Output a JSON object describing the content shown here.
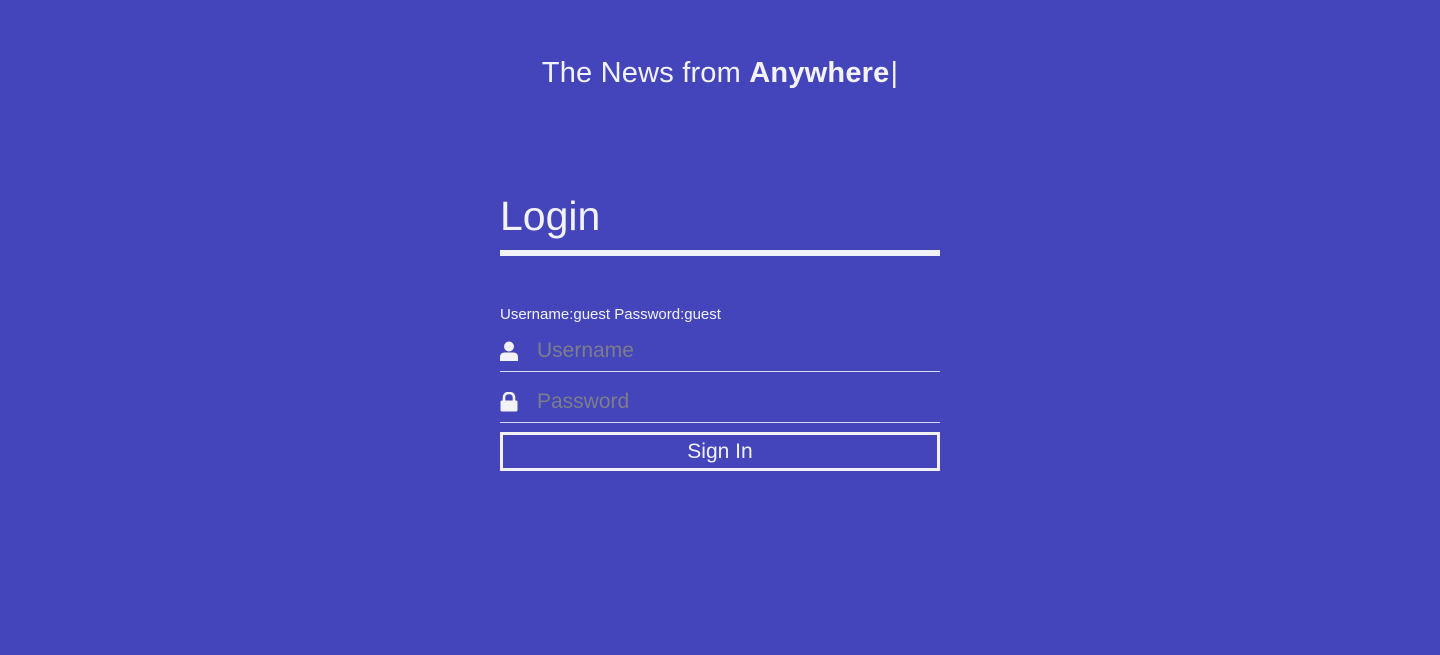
{
  "header": {
    "prefix": "The News from ",
    "emphasis": "Anywhere",
    "cursor": "|"
  },
  "login": {
    "title": "Login",
    "hint": "Username:guest Password:guest",
    "username": {
      "value": "",
      "placeholder": "Username",
      "icon": "user-icon"
    },
    "password": {
      "value": "",
      "placeholder": "Password",
      "icon": "lock-icon"
    },
    "submit_label": "Sign In"
  },
  "colors": {
    "background": "#4444bb",
    "foreground": "#f2f2f8",
    "placeholder": "#7d7d8a"
  }
}
